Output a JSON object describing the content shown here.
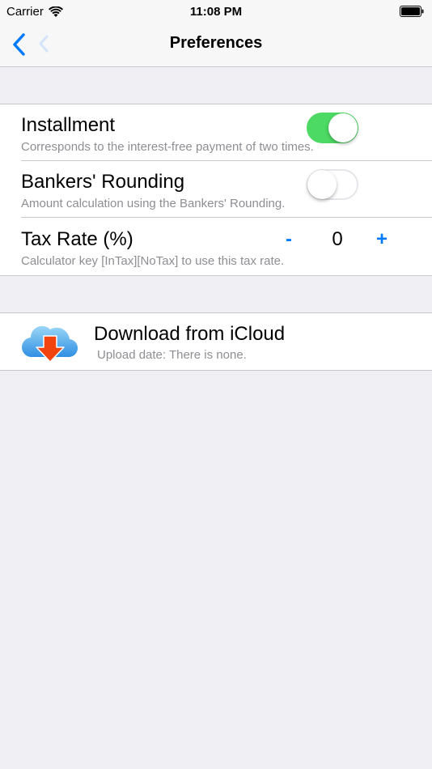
{
  "status_bar": {
    "carrier": "Carrier",
    "time": "11:08 PM"
  },
  "nav": {
    "title": "Preferences"
  },
  "settings": {
    "installment": {
      "title": "Installment",
      "subtitle": "Corresponds to the interest-free payment of two times.",
      "enabled": true
    },
    "bankers_rounding": {
      "title": "Bankers' Rounding",
      "subtitle": "Amount calculation using the Bankers' Rounding.",
      "enabled": false
    },
    "tax_rate": {
      "title": "Tax Rate (%)",
      "subtitle": "Calculator key [InTax][NoTax] to use this tax rate.",
      "minus_label": "-",
      "plus_label": "+",
      "value": "0"
    }
  },
  "icloud": {
    "title": "Download from iCloud",
    "subtitle": "Upload date: There is none."
  },
  "colors": {
    "accent": "#007aff",
    "toggle_on": "#4cd964",
    "background": "#efeff4"
  }
}
